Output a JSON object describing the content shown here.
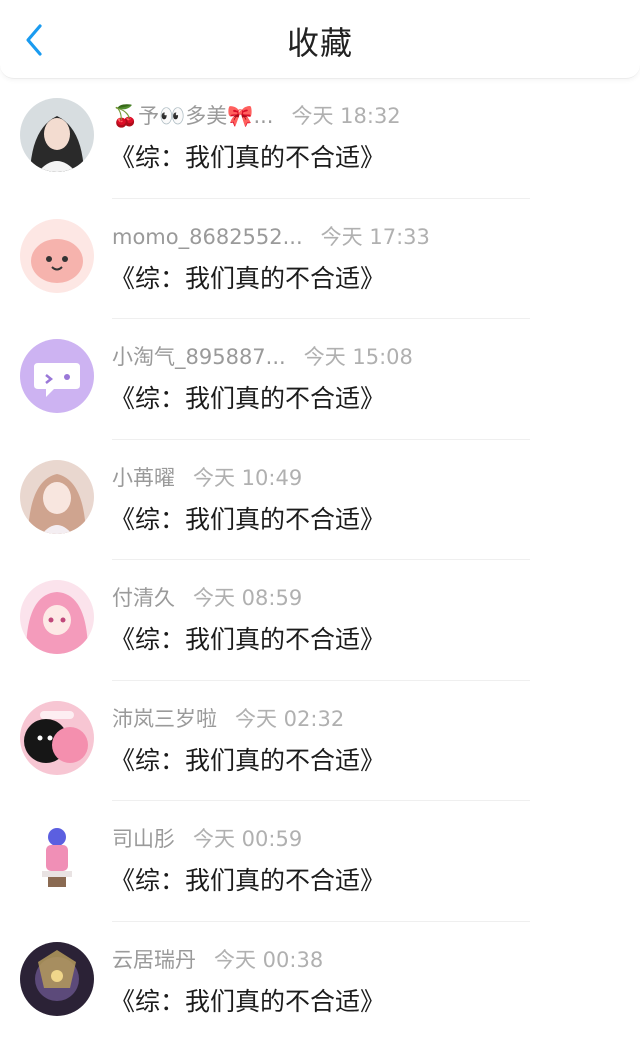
{
  "header": {
    "title": "收藏",
    "back_icon": "chevron-left-icon",
    "accent_color": "#1a9bf0"
  },
  "items": [
    {
      "name": "🍒予👀多美🎀...",
      "time": "今天 18:32",
      "title": "《综：我们真的不合适》",
      "avatar": "portrait-avatar"
    },
    {
      "name": "momo_8682552...",
      "time": "今天 17:33",
      "title": "《综：我们真的不合适》",
      "avatar": "pink-cartoon-avatar"
    },
    {
      "name": "小淘气_895887...",
      "time": "今天 15:08",
      "title": "《综：我们真的不合适》",
      "avatar": "purple-chat-avatar"
    },
    {
      "name": "小苒曜",
      "time": "今天 10:49",
      "title": "《综：我们真的不合适》",
      "avatar": "anime-girl-avatar"
    },
    {
      "name": "付清久",
      "time": "今天 08:59",
      "title": "《综：我们真的不合适》",
      "avatar": "pink-hair-avatar"
    },
    {
      "name": "沛岚三岁啦",
      "time": "今天 02:32",
      "title": "《综：我们真的不合适》",
      "avatar": "black-pink-cartoon-avatar"
    },
    {
      "name": "司山肜",
      "time": "今天 00:59",
      "title": "《综：我们真的不合适》",
      "avatar": "figure-avatar"
    },
    {
      "name": "云居瑞丹",
      "time": "今天 00:38",
      "title": "《综：我们真的不合适》",
      "avatar": "game-hero-avatar"
    }
  ]
}
